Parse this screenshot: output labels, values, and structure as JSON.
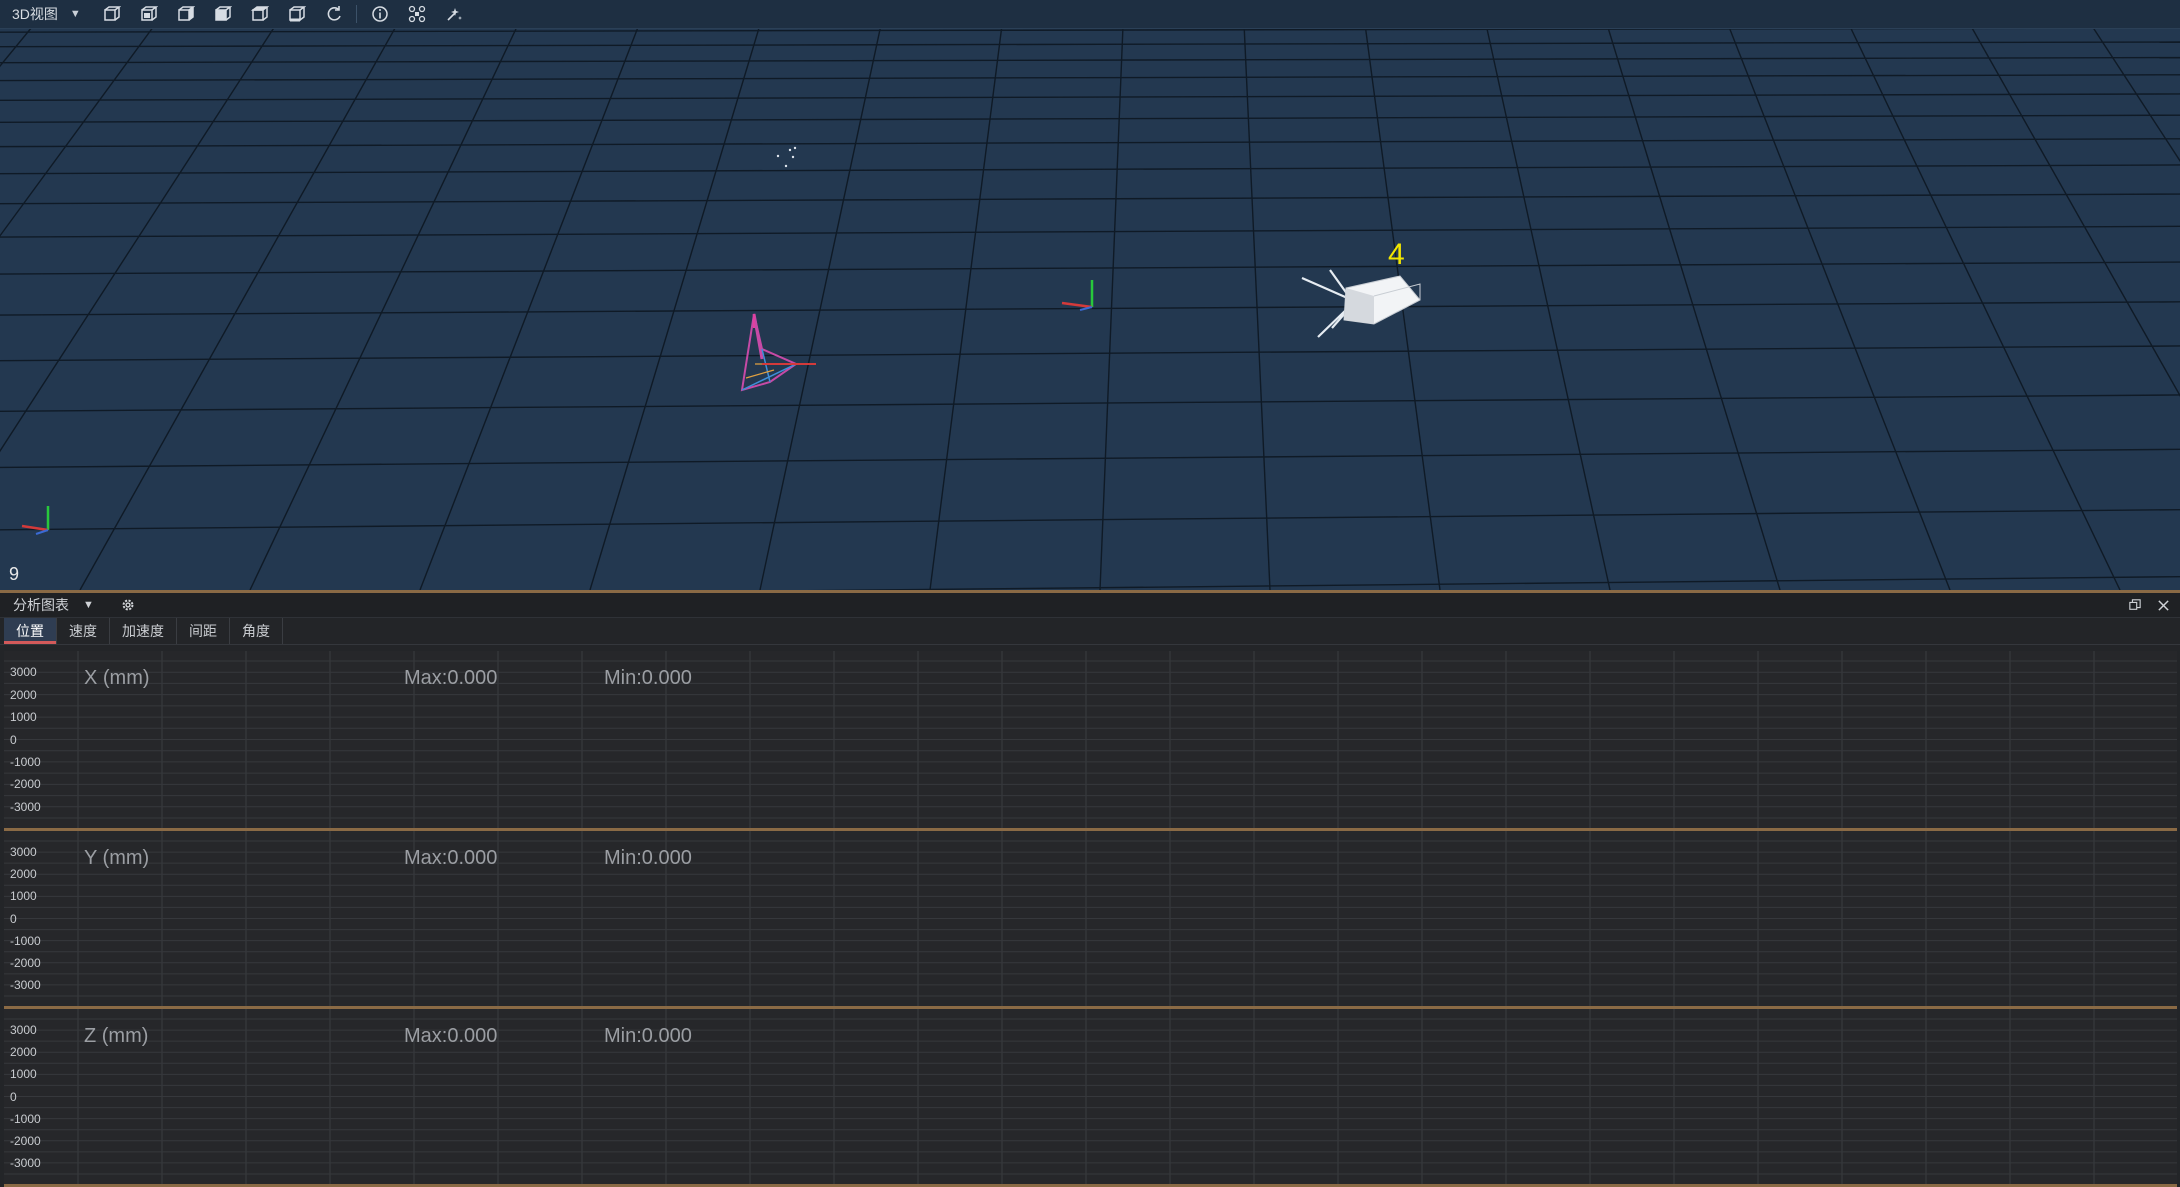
{
  "viewport": {
    "view_select": "3D视图",
    "tools": [
      {
        "name": "front-view-icon"
      },
      {
        "name": "back-view-icon"
      },
      {
        "name": "left-view-icon"
      },
      {
        "name": "right-view-icon"
      },
      {
        "name": "top-view-icon"
      },
      {
        "name": "bottom-view-icon"
      },
      {
        "name": "reset-view-icon"
      },
      {
        "name": "info-icon"
      },
      {
        "name": "drone-icon"
      },
      {
        "name": "clear-trail-icon"
      }
    ],
    "object_label": "4",
    "frame_counter": "9",
    "colors": {
      "background": "#233850",
      "grid": "#0f1a26",
      "label": "#f2e600"
    }
  },
  "panel": {
    "select": "分析图表",
    "tabs": [
      "位置",
      "速度",
      "加速度",
      "间距",
      "角度"
    ],
    "active_tab": 0,
    "charts": [
      {
        "title": "X (mm)",
        "max": "Max:0.000",
        "min": "Min:0.000"
      },
      {
        "title": "Y (mm)",
        "max": "Max:0.000",
        "min": "Min:0.000"
      },
      {
        "title": "Z (mm)",
        "max": "Max:0.000",
        "min": "Min:0.000"
      }
    ],
    "y_ticks": [
      "3000",
      "2000",
      "1000",
      "0",
      "-1000",
      "-2000",
      "-3000"
    ]
  },
  "chart_data": [
    {
      "type": "line",
      "title": "X (mm)",
      "ylim": [
        -3500,
        3500
      ],
      "yticks": [
        3000,
        2000,
        1000,
        0,
        -1000,
        -2000,
        -3000
      ],
      "series": [],
      "grid": true
    },
    {
      "type": "line",
      "title": "Y (mm)",
      "ylim": [
        -3500,
        3500
      ],
      "yticks": [
        3000,
        2000,
        1000,
        0,
        -1000,
        -2000,
        -3000
      ],
      "series": [],
      "grid": true
    },
    {
      "type": "line",
      "title": "Z (mm)",
      "ylim": [
        -3500,
        3500
      ],
      "yticks": [
        3000,
        2000,
        1000,
        0,
        -1000,
        -2000,
        -3000
      ],
      "series": [],
      "grid": true
    }
  ]
}
